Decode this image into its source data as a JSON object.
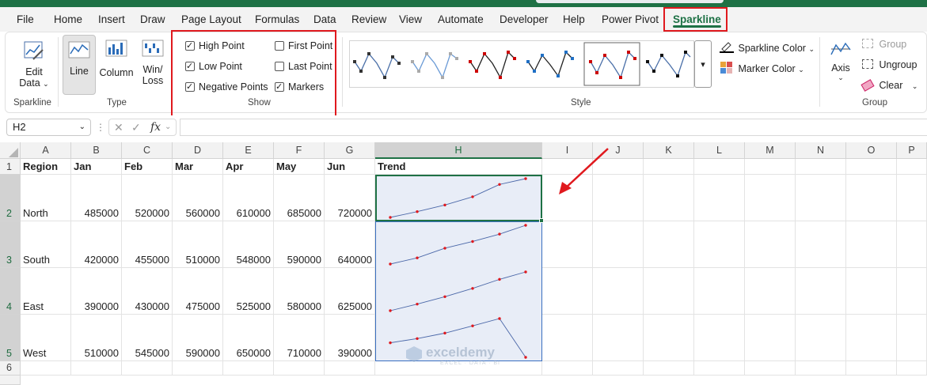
{
  "tabs": [
    "File",
    "Home",
    "Insert",
    "Draw",
    "Page Layout",
    "Formulas",
    "Data",
    "Review",
    "View",
    "Automate",
    "Developer",
    "Help",
    "Power Pivot",
    "Sparkline"
  ],
  "active_tab": "Sparkline",
  "ribbon": {
    "sparkline_group": {
      "edit_data_line1": "Edit",
      "edit_data_line2": "Data",
      "label": "Sparkline"
    },
    "type_group": {
      "line": "Line",
      "column": "Column",
      "winloss_line1": "Win/",
      "winloss_line2": "Loss",
      "label": "Type"
    },
    "show_group": {
      "label": "Show",
      "options": [
        {
          "label": "High Point",
          "checked": true
        },
        {
          "label": "Low Point",
          "checked": true
        },
        {
          "label": "Negative Points",
          "checked": true
        },
        {
          "label": "First Point",
          "checked": false
        },
        {
          "label": "Last Point",
          "checked": false
        },
        {
          "label": "Markers",
          "checked": true
        }
      ]
    },
    "style_group": {
      "label": "Style",
      "sparkline_color": "Sparkline Color",
      "marker_color": "Marker Color"
    },
    "group_group": {
      "axis": "Axis",
      "group": "Group",
      "ungroup": "Ungroup",
      "clear": "Clear",
      "label": "Group"
    }
  },
  "formula_bar": {
    "name_box": "H2",
    "fx": "fx",
    "formula": ""
  },
  "columns": [
    "A",
    "B",
    "C",
    "D",
    "E",
    "F",
    "G",
    "H",
    "I",
    "J",
    "K",
    "L",
    "M",
    "N",
    "O",
    "P"
  ],
  "selected_column": "H",
  "rows": [
    "1",
    "2",
    "3",
    "4",
    "5",
    "6"
  ],
  "selected_rows": [
    "2",
    "3",
    "4",
    "5"
  ],
  "sheet": {
    "headers": [
      "Region",
      "Jan",
      "Feb",
      "Mar",
      "Apr",
      "May",
      "Jun",
      "Trend"
    ],
    "data": [
      {
        "region": "North",
        "values": [
          "485000",
          "520000",
          "560000",
          "610000",
          "685000",
          "720000"
        ]
      },
      {
        "region": "South",
        "values": [
          "420000",
          "455000",
          "510000",
          "548000",
          "590000",
          "640000"
        ]
      },
      {
        "region": "East",
        "values": [
          "390000",
          "430000",
          "475000",
          "525000",
          "580000",
          "625000"
        ]
      },
      {
        "region": "West",
        "values": [
          "510000",
          "545000",
          "590000",
          "650000",
          "710000",
          "390000"
        ]
      }
    ]
  },
  "watermark": {
    "name": "exceldemy",
    "tagline": "EXCEL · DATA · BI"
  },
  "colors": {
    "excel_green": "#1e7145",
    "highlight_red": "#e0191e",
    "sparkline_line": "#4a67a8",
    "marker": "#e0191e",
    "selection_fill": "#e8edf7",
    "selection_border": "#3a6fc0"
  }
}
